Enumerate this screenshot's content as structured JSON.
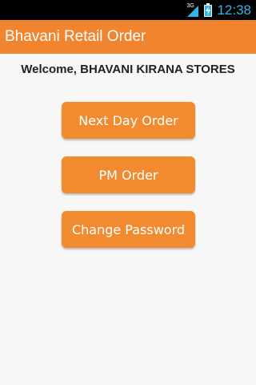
{
  "status_bar": {
    "network": "3G",
    "time": "12:38",
    "icons": [
      "signal-icon",
      "battery-icon"
    ],
    "icon_color": "#33b5e5"
  },
  "action_bar": {
    "title": "Bhavani Retail Order",
    "color": "#f1852f"
  },
  "main": {
    "welcome": "Welcome, BHAVANI KIRANA STORES",
    "buttons": [
      {
        "label": "Next Day Order"
      },
      {
        "label": "PM Order"
      },
      {
        "label": "Change Password"
      }
    ],
    "button_color": "#f28b30"
  }
}
